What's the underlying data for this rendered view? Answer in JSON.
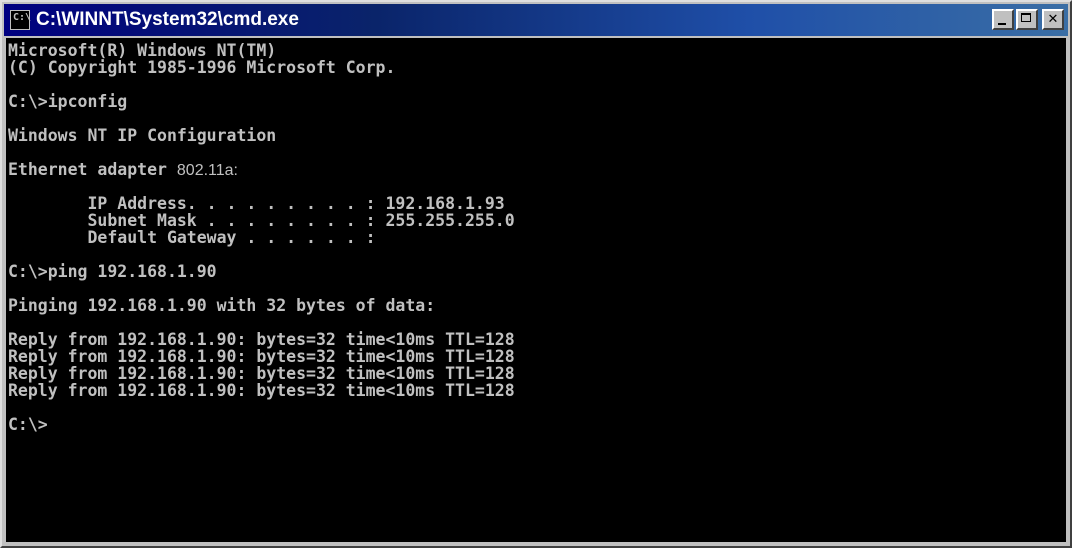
{
  "window": {
    "title": "C:\\WINNT\\System32\\cmd.exe",
    "icon": "cmd-icon",
    "icon_glyph": "C:\\",
    "controls": {
      "minimize": "minimize-icon",
      "maximize": "maximize-icon",
      "close": "close-icon",
      "close_glyph": "✕"
    },
    "colors": {
      "titlebar": "#0a246a",
      "console_bg": "#000000",
      "console_text": "#c0c0c0"
    }
  },
  "console": {
    "banner_line1": "Microsoft(R) Windows NT(TM)",
    "banner_line2": "(C) Copyright 1985-1996 Microsoft Corp.",
    "cmd1": "C:\\>ipconfig",
    "config_title": "Windows NT IP Configuration",
    "adapter_prefix": "Ethernet adapter ",
    "adapter_name": "802.11a",
    "adapter_suffix": ":",
    "ip_line": "        IP Address. . . . . . . . . : 192.168.1.93",
    "mask_line": "        Subnet Mask . . . . . . . . : 255.255.255.0",
    "gateway_line": "        Default Gateway . . . . . . :",
    "cmd2": "C:\\>ping 192.168.1.90",
    "pinging": "Pinging 192.168.1.90 with 32 bytes of data:",
    "replies": [
      "Reply from 192.168.1.90: bytes=32 time<10ms TTL=128",
      "Reply from 192.168.1.90: bytes=32 time<10ms TTL=128",
      "Reply from 192.168.1.90: bytes=32 time<10ms TTL=128",
      "Reply from 192.168.1.90: bytes=32 time<10ms TTL=128"
    ],
    "prompt": "C:\\>"
  }
}
